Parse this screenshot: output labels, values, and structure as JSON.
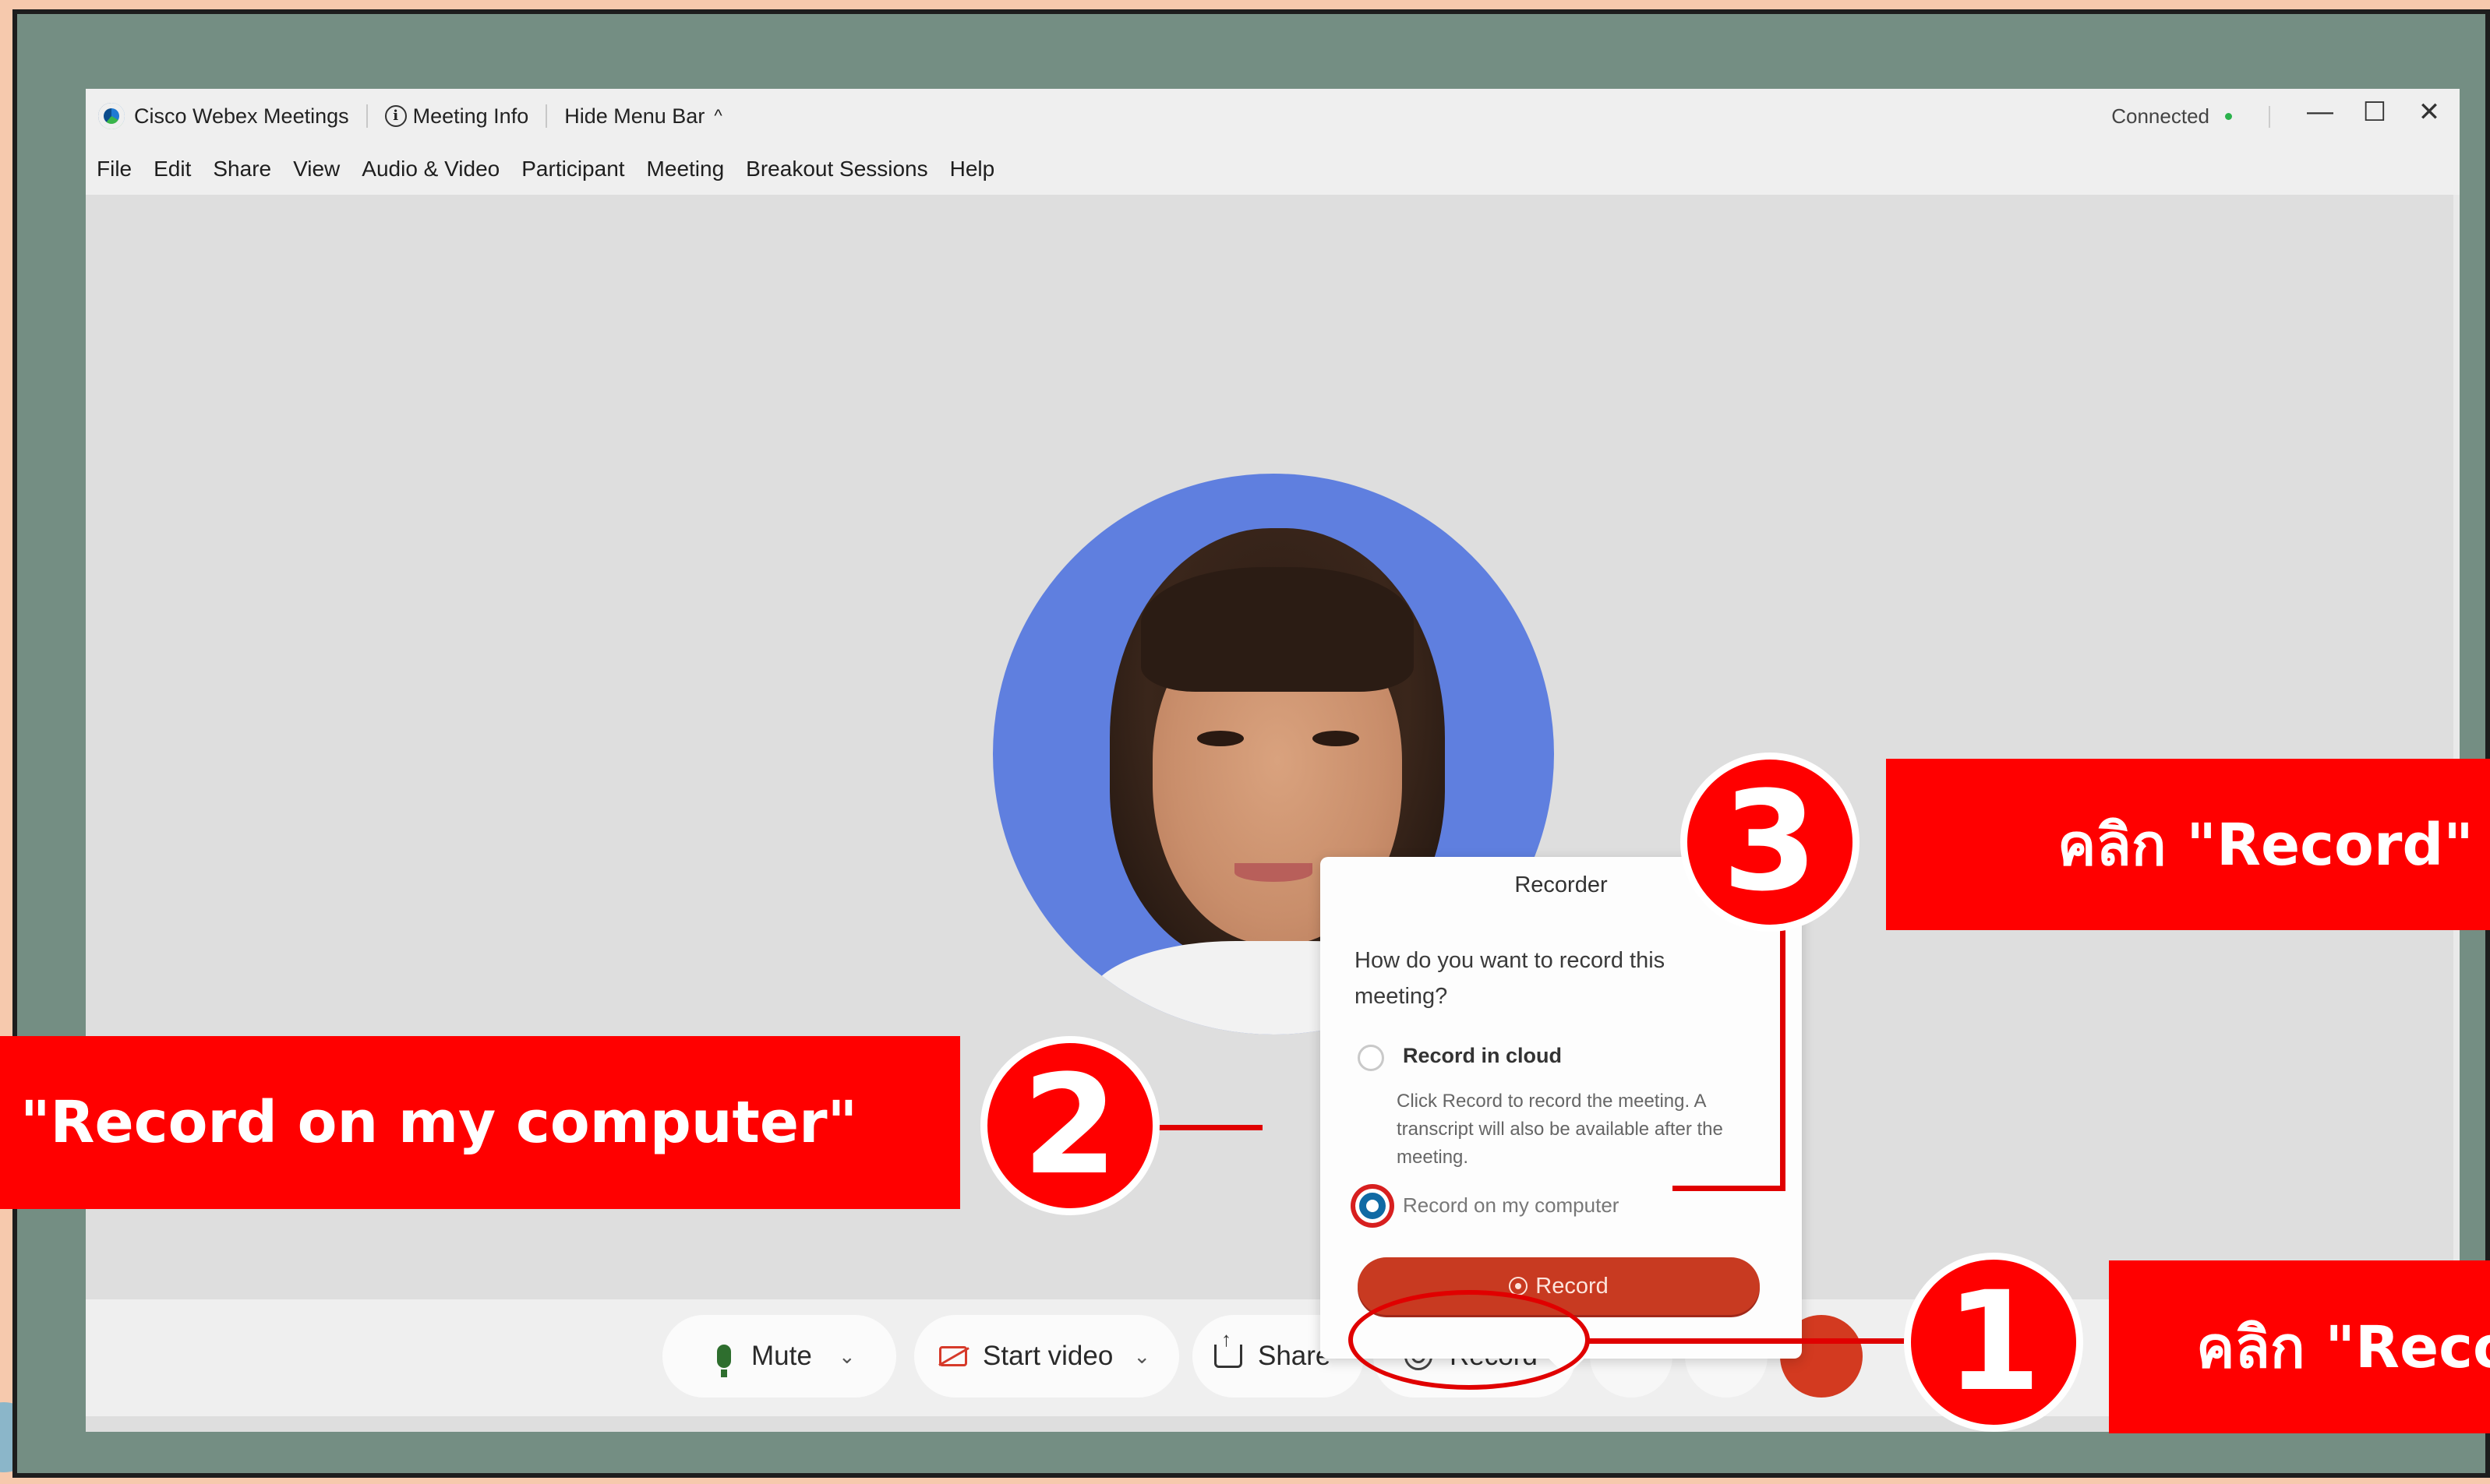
{
  "window": {
    "app_title": "Cisco Webex Meetings",
    "meeting_info": "Meeting Info",
    "hide_menu_bar": "Hide Menu Bar",
    "status": "Connected",
    "controls": {
      "minimize": "—",
      "maximize": "☐",
      "close": "✕"
    }
  },
  "menu": [
    "File",
    "Edit",
    "Share",
    "View",
    "Audio & Video",
    "Participant",
    "Meeting",
    "Breakout Sessions",
    "Help"
  ],
  "recorder": {
    "title": "Recorder",
    "close": "×",
    "question": "How do you want to record this meeting?",
    "option_cloud": "Record in cloud",
    "option_cloud_desc": "Click Record to record the meeting. A transcript will also be available after the meeting.",
    "option_computer": "Record on my computer",
    "selected": "option_computer",
    "button": "Record"
  },
  "controls": {
    "mute": "Mute",
    "start_video": "Start video",
    "share": "Share",
    "record": "Record",
    "chevron": "⌄"
  },
  "annotations": {
    "step1_number": "1",
    "step1_label": "คลิก \"Record\"",
    "step2_number": "2",
    "step2_label": "\"Record on my computer\"",
    "step3_number": "3",
    "step3_label": "คลิก \"Record\""
  },
  "colors": {
    "frame": "#748e83",
    "background": "#f6c9ad",
    "annotation_red": "#ff0000",
    "record_button": "#c83a21",
    "radio_selected": "#106aa4"
  },
  "icons": [
    "webex-logo-icon",
    "info-icon",
    "chevron-up-icon",
    "mic-icon",
    "video-off-icon",
    "share-icon",
    "record-icon",
    "chevron-down-icon",
    "minimize-icon",
    "maximize-icon",
    "close-icon"
  ]
}
